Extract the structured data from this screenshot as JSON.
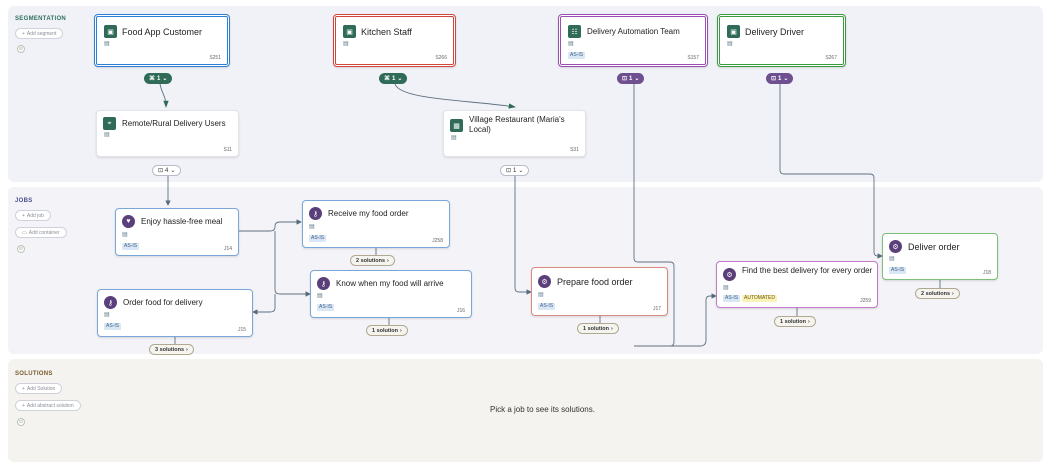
{
  "lanes": {
    "segmentation": {
      "title": "SEGMENTATION",
      "add_label": "Add segment"
    },
    "jobs": {
      "title": "JOBS",
      "add_job": "Add job",
      "add_container": "Add container"
    },
    "solutions": {
      "title": "SOLUTIONS",
      "add_solution": "Add Solution",
      "add_abstract": "Add abstract solution",
      "empty_message": "Pick a job to see its solutions."
    }
  },
  "segments": [
    {
      "title": "Food App Customer",
      "id": "S251",
      "accent": "#2b7fd4",
      "badge": "1"
    },
    {
      "title": "Kitchen Staff",
      "id": "S266",
      "accent": "#d0463b",
      "badge": "1"
    },
    {
      "title": "Delivery Automation Team",
      "id": "S157",
      "accent": "#9a4fb0",
      "tag": "AS-IS",
      "badge": "1"
    },
    {
      "title": "Delivery Driver",
      "id": "S267",
      "accent": "#3a9a3f",
      "badge": "1"
    }
  ],
  "sub_segments": [
    {
      "title": "Remote/Rural Delivery Users",
      "id": "S11",
      "badge": "4"
    },
    {
      "title": "Village Restaurant (Maria's Local)",
      "id": "S31",
      "badge": "1"
    }
  ],
  "jobs": [
    {
      "title": "Enjoy hassle-free meal",
      "id": "J14",
      "tag": "AS-IS",
      "accent": "#7aa7d9"
    },
    {
      "title": "Receive my food order",
      "id": "J258",
      "tag": "AS-IS",
      "accent": "#7aa7d9",
      "solutions": "2 solutions"
    },
    {
      "title": "Know when my food will arrive",
      "id": "J16",
      "tag": "AS-IS",
      "accent": "#7aa7d9",
      "solutions": "1 solution"
    },
    {
      "title": "Order food for delivery",
      "id": "J15",
      "tag": "AS-IS",
      "accent": "#7aa7d9",
      "solutions": "3 solutions"
    },
    {
      "title": "Prepare food order",
      "id": "J17",
      "tag": "AS-IS",
      "accent": "#d98a80",
      "solutions": "1 solution"
    },
    {
      "title": "Find the best delivery for every order",
      "id": "J259",
      "tag": "AS-IS",
      "tag2": "AUTOMATED",
      "accent": "#c07ac8",
      "solutions": "1 solution"
    },
    {
      "title": "Deliver order",
      "id": "J18",
      "tag": "AS-IS",
      "accent": "#7cc07c",
      "solutions": "2 solutions"
    }
  ],
  "icons": {
    "segment": "id-card-icon",
    "team": "team-icon",
    "pin": "location-pin-icon",
    "building": "building-icon",
    "heart": "heart-icon",
    "key": "key-icon",
    "gear": "gear-icon",
    "doc": "document-icon"
  }
}
